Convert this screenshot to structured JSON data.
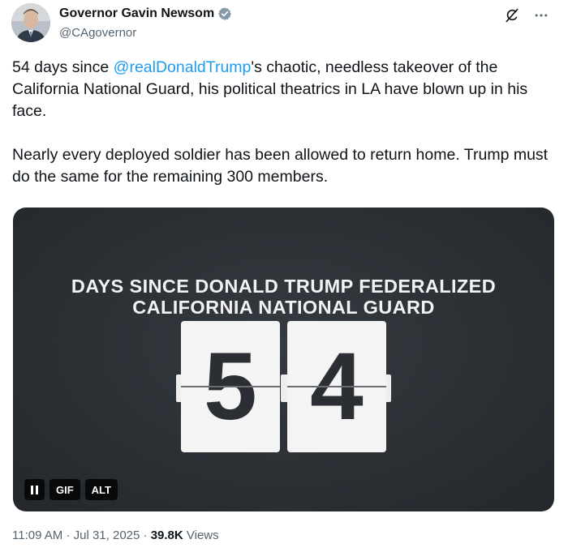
{
  "author": {
    "display_name": "Governor Gavin Newsom",
    "handle": "@CAgovernor"
  },
  "tweet": {
    "paragraph1_prefix": "54 days since ",
    "mention": "@realDonaldTrump",
    "paragraph1_suffix": "'s chaotic, needless takeover of the California National Guard, his political theatrics in LA have blown up in his face.",
    "paragraph2": "Nearly every deployed soldier has been allowed to return home. Trump must do the same for the remaining 300 members."
  },
  "media": {
    "headline_line1": "DAYS SINCE DONALD TRUMP FEDERALIZED",
    "headline_line2": "CALIFORNIA NATIONAL GUARD",
    "digit1": "5",
    "digit2": "4",
    "gif_label": "GIF",
    "alt_label": "ALT"
  },
  "meta": {
    "time": "11:09 AM",
    "separator": " · ",
    "date": "Jul 31, 2025",
    "views_count": "39.8K",
    "views_label": " Views"
  },
  "icons": {
    "verified": "verified-badge-icon",
    "grok": "grok-icon",
    "more": "more-icon",
    "pause": "pause-icon"
  },
  "colors": {
    "accent": "#1d9bf0",
    "text": "#0f1419",
    "secondary": "#536471",
    "media_bg": "#2e3338"
  }
}
